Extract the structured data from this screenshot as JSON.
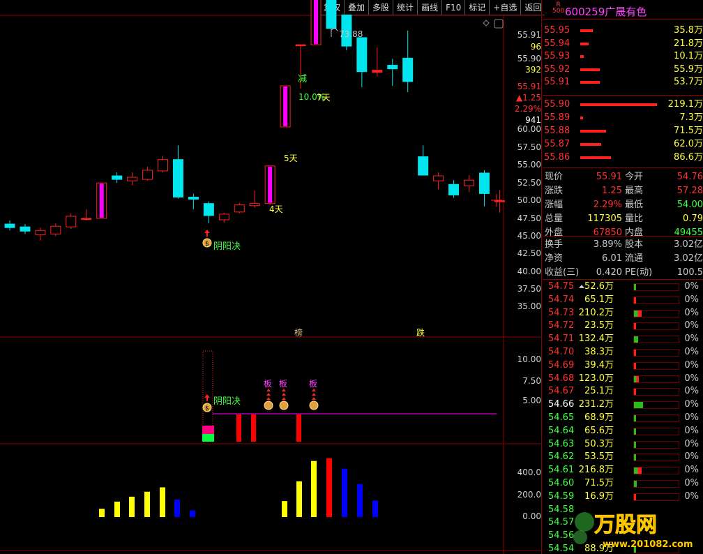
{
  "toolbar": [
    "复权",
    "叠加",
    "多股",
    "统计",
    "画线",
    "F10",
    "标记",
    "+自选",
    "返回"
  ],
  "stock": {
    "badge_top": "R",
    "badge_bottom": "500",
    "code": "600259",
    "name": "广晟有色"
  },
  "orderbook_sell": [
    {
      "price": "55.95",
      "vol": "35.8万",
      "bar": 0.08
    },
    {
      "price": "55.94",
      "vol": "21.8万",
      "bar": 0.05
    },
    {
      "price": "55.93",
      "vol": "10.1万",
      "bar": 0.02
    },
    {
      "price": "55.92",
      "vol": "55.9万",
      "bar": 0.12
    },
    {
      "price": "55.91",
      "vol": "53.7万",
      "bar": 0.12
    }
  ],
  "orderbook_buy": [
    {
      "price": "55.90",
      "vol": "219.1万",
      "bar": 0.48
    },
    {
      "price": "55.89",
      "vol": "7.3万",
      "bar": 0.015
    },
    {
      "price": "55.88",
      "vol": "71.5万",
      "bar": 0.16
    },
    {
      "price": "55.87",
      "vol": "62.0万",
      "bar": 0.13
    },
    {
      "price": "55.86",
      "vol": "86.6万",
      "bar": 0.19
    }
  ],
  "quote": [
    {
      "l1": "现价",
      "v1": "55.91",
      "c1": "#ff3030",
      "l2": "今开",
      "v2": "54.76",
      "c2": "#ff3030"
    },
    {
      "l1": "涨跌",
      "v1": "1.25",
      "c1": "#ff3030",
      "l2": "最高",
      "v2": "57.28",
      "c2": "#ff3030"
    },
    {
      "l1": "涨幅",
      "v1": "2.29%",
      "c1": "#ff3030",
      "l2": "最低",
      "v2": "54.00",
      "c2": "#40ff40"
    },
    {
      "l1": "总量",
      "v1": "117305",
      "c1": "#ffff40",
      "l2": "量比",
      "v2": "0.79",
      "c2": "#ffff40"
    },
    {
      "l1": "外盘",
      "v1": "67850",
      "c1": "#ff3030",
      "l2": "内盘",
      "v2": "49455",
      "c2": "#40ff40"
    }
  ],
  "quote2": [
    {
      "l1": "换手",
      "v1": "3.89%",
      "c1": "#c8c8c8",
      "l2": "股本",
      "v2": "3.02亿",
      "c2": "#c8c8c8"
    },
    {
      "l1": "净资",
      "v1": "6.01",
      "c1": "#c8c8c8",
      "l2": "流通",
      "v2": "3.02亿",
      "c2": "#c8c8c8"
    },
    {
      "l1": "收益(三)",
      "v1": "0.420",
      "c1": "#c8c8c8",
      "l2": "PE(动)",
      "v2": "100.5",
      "c2": "#c8c8c8"
    }
  ],
  "ticks": [
    {
      "price": "54.75",
      "vol": "52.6万",
      "pct": "0%",
      "pc": "#ff3030",
      "fill": 0.05,
      "fc": "#20c020",
      "arrow": true
    },
    {
      "price": "54.74",
      "vol": "65.1万",
      "pct": "0%",
      "pc": "#ff3030",
      "fill": 0.04,
      "fc": "#ff2020"
    },
    {
      "price": "54.73",
      "vol": "210.2万",
      "pct": "0%",
      "pc": "#ff3030",
      "fill": 0.16,
      "fc": "mix"
    },
    {
      "price": "54.72",
      "vol": "23.5万",
      "pct": "0%",
      "pc": "#ff3030",
      "fill": 0.03,
      "fc": "#ff2020"
    },
    {
      "price": "54.71",
      "vol": "132.4万",
      "pct": "0%",
      "pc": "#ff3030",
      "fill": 0.09,
      "fc": "#20c020"
    },
    {
      "price": "54.70",
      "vol": "38.3万",
      "pct": "0%",
      "pc": "#ff3030",
      "fill": 0.03,
      "fc": "#ff2020"
    },
    {
      "price": "54.69",
      "vol": "39.4万",
      "pct": "0%",
      "pc": "#ff3030",
      "fill": 0.03,
      "fc": "#ff2020"
    },
    {
      "price": "54.68",
      "vol": "123.0万",
      "pct": "0%",
      "pc": "#ff3030",
      "fill": 0.1,
      "fc": "mix"
    },
    {
      "price": "54.67",
      "vol": "25.1万",
      "pct": "0%",
      "pc": "#ff3030",
      "fill": 0.03,
      "fc": "#ff2020"
    },
    {
      "price": "54.66",
      "vol": "231.2万",
      "pct": "0%",
      "pc": "#ffffff",
      "fill": 0.2,
      "fc": "#20c020"
    },
    {
      "price": "54.65",
      "vol": "68.9万",
      "pct": "0%",
      "pc": "#40ff40",
      "fill": 0.05,
      "fc": "#20c020"
    },
    {
      "price": "54.64",
      "vol": "65.6万",
      "pct": "0%",
      "pc": "#40ff40",
      "fill": 0.05,
      "fc": "#20c020"
    },
    {
      "price": "54.63",
      "vol": "50.3万",
      "pct": "0%",
      "pc": "#40ff40",
      "fill": 0.04,
      "fc": "#20c020"
    },
    {
      "price": "54.62",
      "vol": "53.5万",
      "pct": "0%",
      "pc": "#40ff40",
      "fill": 0.04,
      "fc": "#20c020"
    },
    {
      "price": "54.61",
      "vol": "216.8万",
      "pct": "0%",
      "pc": "#40ff40",
      "fill": 0.16,
      "fc": "mix"
    },
    {
      "price": "54.60",
      "vol": "71.5万",
      "pct": "0%",
      "pc": "#40ff40",
      "fill": 0.06,
      "fc": "#20c020"
    },
    {
      "price": "54.59",
      "vol": "16.9万",
      "pct": "0%",
      "pc": "#40ff40",
      "fill": 0.02,
      "fc": "#ff2020"
    },
    {
      "price": "54.58",
      "vol": "",
      "pct": "",
      "pc": "#40ff40",
      "fill": 0,
      "fc": "#20c020"
    },
    {
      "price": "54.57",
      "vol": "",
      "pct": "",
      "pc": "#40ff40",
      "fill": 0,
      "fc": "#20c020"
    },
    {
      "price": "54.56",
      "vol": "",
      "pct": "",
      "pc": "#40ff40",
      "fill": 0,
      "fc": "#20c020"
    },
    {
      "price": "54.54",
      "vol": "88.9万",
      "pct": "",
      "pc": "#40ff40",
      "fill": 0,
      "fc": "#20c020"
    }
  ],
  "price_axis": [
    "55.91",
    "96",
    "55.90",
    "392",
    "55.91",
    "▲1.25",
    "2.29%",
    "941",
    "60.00",
    "57.50",
    "55.00",
    "52.50",
    "50.00",
    "47.50",
    "45.00",
    "42.50",
    "40.00",
    "37.50",
    "35.00"
  ],
  "price_axis_colors": [
    "#d0d0d0",
    "#ffff40",
    "#d0d0d0",
    "#ffff40",
    "#ff3030",
    "#ff3030",
    "#ff3030",
    "#ffffff",
    "#d0d0d0",
    "#d0d0d0",
    "#d0d0d0",
    "#d0d0d0",
    "#d0d0d0",
    "#d0d0d0",
    "#d0d0d0",
    "#d0d0d0",
    "#d0d0d0",
    "#d0d0d0",
    "#d0d0d0"
  ],
  "mid_axis": [
    "10.00",
    "7.50",
    "5.00"
  ],
  "vol_axis": [
    "400.0",
    "200.0",
    "0.00"
  ],
  "annotations": {
    "high": "73.88",
    "jian": "减",
    "pct10": "10.0%",
    "tian7": "7天",
    "tian5": "5天",
    "tian4": "4天",
    "yinyang": "阴阳决",
    "yinyang2": "阴阳决",
    "bang": "榜",
    "die": "跌",
    "ban1": "板",
    "ban2": "板",
    "ban3": "板"
  },
  "watermark": {
    "text": "万股网",
    "url": "www.201082.com"
  },
  "candles": [
    {
      "o": 46.7,
      "c": 46.2,
      "h": 47.2,
      "l": 45.8,
      "t": "c"
    },
    {
      "o": 46.3,
      "c": 45.7,
      "h": 46.7,
      "l": 45.3,
      "t": "c"
    },
    {
      "o": 45.2,
      "c": 45.8,
      "h": 46.2,
      "l": 44.4,
      "t": "r"
    },
    {
      "o": 45.3,
      "c": 46.4,
      "h": 46.8,
      "l": 45.0,
      "t": "r"
    },
    {
      "o": 46.3,
      "c": 47.8,
      "h": 48.2,
      "l": 46.0,
      "t": "r"
    },
    {
      "o": 47.5,
      "c": 47.5,
      "h": 48.8,
      "l": 47.2,
      "t": "d"
    },
    {
      "o": 47.5,
      "c": 52.5,
      "h": 52.5,
      "l": 47.5,
      "t": "m"
    },
    {
      "o": 53.0,
      "c": 53.5,
      "h": 54.0,
      "l": 52.5,
      "t": "c"
    },
    {
      "o": 52.8,
      "c": 53.3,
      "h": 54.0,
      "l": 52.2,
      "t": "r"
    },
    {
      "o": 53.0,
      "c": 54.3,
      "h": 54.8,
      "l": 52.8,
      "t": "r"
    },
    {
      "o": 54.2,
      "c": 55.8,
      "h": 56.3,
      "l": 54.0,
      "t": "r"
    },
    {
      "o": 55.8,
      "c": 50.5,
      "h": 57.8,
      "l": 50.3,
      "t": "c"
    },
    {
      "o": 50.5,
      "c": 50.2,
      "h": 51.0,
      "l": 48.8,
      "t": "c"
    },
    {
      "o": 49.6,
      "c": 47.9,
      "h": 49.9,
      "l": 46.8,
      "t": "c"
    },
    {
      "o": 47.3,
      "c": 48.1,
      "h": 48.3,
      "l": 46.9,
      "t": "r"
    },
    {
      "o": 48.4,
      "c": 49.4,
      "h": 49.7,
      "l": 48.2,
      "t": "r"
    },
    {
      "o": 49.3,
      "c": 49.6,
      "h": 51.4,
      "l": 49.0,
      "t": "r"
    },
    {
      "o": 49.6,
      "c": 54.9,
      "h": 54.9,
      "l": 49.4,
      "t": "m"
    },
    {
      "o": 60.4,
      "c": 66.2,
      "h": 66.2,
      "l": 60.4,
      "t": "m"
    },
    {
      "o": 72.0,
      "c": 72.0,
      "h": 72.0,
      "l": 65.8,
      "t": "d"
    },
    {
      "o": 72.0,
      "c": 79.2,
      "h": 79.2,
      "l": 72.0,
      "t": "m"
    },
    {
      "o": 78.5,
      "c": 74.3,
      "h": 80.2,
      "l": 73.6,
      "t": "c"
    },
    {
      "o": 76.2,
      "c": 71.8,
      "h": 76.2,
      "l": 71.2,
      "t": "c"
    },
    {
      "o": 73.0,
      "c": 68.2,
      "h": 73.0,
      "l": 66.0,
      "t": "c"
    },
    {
      "o": 68.1,
      "c": 68.4,
      "h": 71.6,
      "l": 67.5,
      "t": "d"
    },
    {
      "o": 68.6,
      "c": 69.1,
      "h": 70.0,
      "l": 66.2,
      "t": "c"
    },
    {
      "o": 70.1,
      "c": 66.8,
      "h": 74.0,
      "l": 65.3,
      "t": "c"
    },
    {
      "o": 56.2,
      "c": 53.6,
      "h": 57.8,
      "l": 53.6,
      "t": "c"
    },
    {
      "o": 52.8,
      "c": 53.5,
      "h": 54.0,
      "l": 51.6,
      "t": "r"
    },
    {
      "o": 52.3,
      "c": 50.8,
      "h": 52.9,
      "l": 50.4,
      "t": "c"
    },
    {
      "o": 52.1,
      "c": 52.9,
      "h": 53.6,
      "l": 51.2,
      "t": "r"
    },
    {
      "o": 53.9,
      "c": 51.0,
      "h": 54.3,
      "l": 49.2,
      "t": "c"
    },
    {
      "o": 50.0,
      "c": 50.0,
      "h": 51.5,
      "l": 48.3,
      "t": "d"
    }
  ],
  "vol_bars": [
    {
      "v": 75,
      "c": "#ffff00"
    },
    {
      "v": 140,
      "c": "#ffff00"
    },
    {
      "v": 185,
      "c": "#ffff00"
    },
    {
      "v": 230,
      "c": "#ffff00"
    },
    {
      "v": 270,
      "c": "#ffff00"
    },
    {
      "v": 160,
      "c": "#0000ff"
    },
    {
      "v": 60,
      "c": "#0000ff"
    },
    {
      "v": 145,
      "c": "#ffff00"
    },
    {
      "v": 325,
      "c": "#ffff00"
    },
    {
      "v": 510,
      "c": "#ffff00"
    },
    {
      "v": 535,
      "c": "#ff0000"
    },
    {
      "v": 440,
      "c": "#0000ff"
    },
    {
      "v": 300,
      "c": "#0000ff"
    },
    {
      "v": 150,
      "c": "#0000ff"
    }
  ]
}
